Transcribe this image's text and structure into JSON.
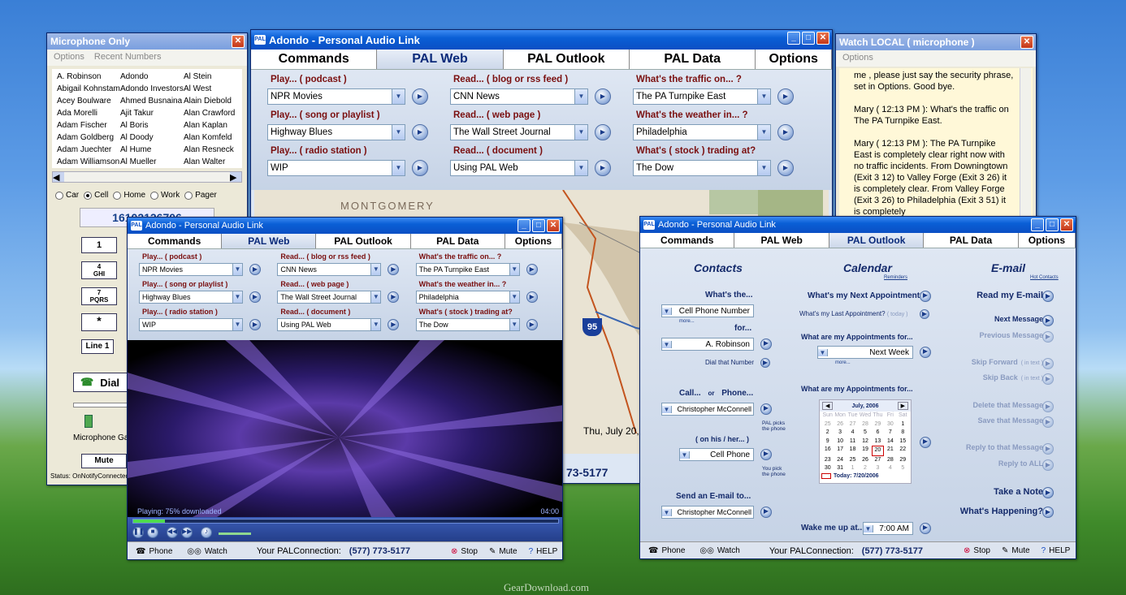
{
  "watermark": "GearDownload.com",
  "mic": {
    "title": "Microphone Only",
    "menu": [
      "Options",
      "Recent Numbers"
    ],
    "contacts": [
      [
        "A. Robinson",
        "Adondo",
        "Al Stein"
      ],
      [
        "Abigail Kohnstamm",
        "Adondo Investors",
        "Al West"
      ],
      [
        "Acey Boulware",
        "Ahmed Busnaina",
        "Alain Diebold"
      ],
      [
        "Ada Morelli",
        "Ajit Takur",
        "Alan Crawford"
      ],
      [
        "Adam Fischer",
        "Al Boris",
        "Alan Kaplan"
      ],
      [
        "Adam Goldberg",
        "Al Doody",
        "Alan Komfeld"
      ],
      [
        "Adam Juechter",
        "Al Hume",
        "Alan Resneck"
      ],
      [
        "Adam Williamson",
        "Al Mueller",
        "Alan Walter"
      ]
    ],
    "radios": [
      "Car",
      "Cell",
      "Home",
      "Work",
      "Pager"
    ],
    "selected_radio": "Cell",
    "number": "16102126706",
    "keys": [
      "1",
      "4\nGHI",
      "7\nPQRS",
      "*"
    ],
    "line": "Line 1",
    "dial": "Dial",
    "gain": "Microphone Gain",
    "mute": "Mute",
    "status": "Status: OnNotifyConnected"
  },
  "main": {
    "title": "Adondo - Personal Audio Link",
    "tabs": [
      "Commands",
      "PAL Web",
      "PAL Outlook",
      "PAL Data",
      "Options"
    ],
    "active_tab": "PAL Web",
    "cols": [
      [
        {
          "label": "Play... ( podcast )",
          "value": "NPR Movies"
        },
        {
          "label": "Play... ( song or playlist )",
          "value": "Highway Blues"
        },
        {
          "label": "Play... ( radio station )",
          "value": "WIP"
        }
      ],
      [
        {
          "label": "Read... ( blog or rss feed )",
          "value": "CNN News"
        },
        {
          "label": "Read... ( web page )",
          "value": "The Wall Street Journal"
        },
        {
          "label": "Read... ( document )",
          "value": "Using PAL Web"
        }
      ],
      [
        {
          "label": "What's the traffic on... ?",
          "value": "The PA Turnpike East"
        },
        {
          "label": "What's the weather in... ?",
          "value": "Philadelphia"
        },
        {
          "label": "What's ( stock ) trading at?",
          "value": "The Dow"
        }
      ]
    ],
    "map_label": "MONTGOMERY",
    "map_date": "Thu, July 20, 2",
    "map_road": "95",
    "phone_tail": "73-5177"
  },
  "watch": {
    "title": "Watch LOCAL ( microphone )",
    "menu": "Options",
    "paras": [
      "me , please just say the security phrase, set in Options.  Good bye.",
      "Mary ( 12:13 PM ): What's the traffic on The PA Turnpike East.",
      "Mary ( 12:13 PM ): The PA Turnpike East is completely clear right now with no traffic incidents.  From Downingtown (Exit 3 12) to Valley Forge (Exit 3 26) it is completely clear. From Valley Forge (Exit 3 26) to Philadelphia (Exit 3 51) it is completely"
    ]
  },
  "web2": {
    "title": "Adondo - Personal Audio Link",
    "tabs": [
      "Commands",
      "PAL Web",
      "PAL Outlook",
      "PAL Data",
      "Options"
    ],
    "active_tab": "PAL Web",
    "playing": "Playing: 75% downloaded",
    "time": "04:00",
    "playing_progress": 0.75,
    "status": {
      "phone": "Phone",
      "watch": "Watch",
      "conn_label": "Your PALConnection:",
      "conn_number": "(577) 773-5177",
      "stop": "Stop",
      "mute": "Mute",
      "help": "HELP"
    }
  },
  "outlook": {
    "title": "Adondo - Personal Audio Link",
    "tabs": [
      "Commands",
      "PAL Web",
      "PAL Outlook",
      "PAL Data",
      "Options"
    ],
    "active_tab": "PAL Outlook",
    "contacts_h": "Contacts",
    "calendar_h": "Calendar",
    "email_h": "E-mail",
    "reminders": "Reminders",
    "hot": "Hot Contacts",
    "whats_the": "What's the...",
    "cell": "Cell Phone Number",
    "more": "more...",
    "for": "for...",
    "person": "A. Robinson",
    "dial_that": "Dial that Number",
    "call": "Call...",
    "or": "or",
    "phone": "Phone...",
    "call_person": "Christopher McConnell",
    "pal_picks": "PAL picks the phone",
    "on_his": "( on his / her... )",
    "cell2": "Cell Phone",
    "you_pick": "You pick the phone",
    "send_email": "Send an E-mail to...",
    "email_person": "Christopher McConnell",
    "next_appt": "What's my Next Appointment?",
    "last_appt": "What's my Last Appointment?",
    "today_tag": "( today )",
    "appts_for": "What are my Appointments for...",
    "next_week": "Next Week",
    "appts_for2": "What are my Appointments for...",
    "month": "July, 2006",
    "dow": [
      "Sun",
      "Mon",
      "Tue",
      "Wed",
      "Thu",
      "Fri",
      "Sat"
    ],
    "days": [
      [
        "25",
        "26",
        "27",
        "28",
        "29",
        "30",
        "1"
      ],
      [
        "2",
        "3",
        "4",
        "5",
        "6",
        "7",
        "8"
      ],
      [
        "9",
        "10",
        "11",
        "12",
        "13",
        "14",
        "15"
      ],
      [
        "16",
        "17",
        "18",
        "19",
        "20",
        "21",
        "22"
      ],
      [
        "23",
        "24",
        "25",
        "26",
        "27",
        "28",
        "29"
      ],
      [
        "30",
        "31",
        "1",
        "2",
        "3",
        "4",
        "5"
      ]
    ],
    "today": "Today: 7/20/2006",
    "wake": "Wake me up at...",
    "wake_time": "7:00 AM",
    "read_email": "Read my E-mail",
    "next_msg": "Next Message",
    "prev_msg": "Previous Message",
    "skip_fwd": "Skip Forward",
    "skip_back": "Skip Back",
    "in_text": "( in text )",
    "delete": "Delete that Message",
    "save": "Save that Message",
    "reply": "Reply to that Message",
    "reply_all": "Reply to ALL",
    "note": "Take a Note",
    "happening": "What's Happening?",
    "status": {
      "phone": "Phone",
      "watch": "Watch",
      "conn_label": "Your PALConnection:",
      "conn_number": "(577) 773-5177",
      "stop": "Stop",
      "mute": "Mute",
      "help": "HELP"
    }
  },
  "colors": {
    "accent": "#0a4fc4",
    "label": "#7a0f0f",
    "navy": "#142a6b"
  }
}
